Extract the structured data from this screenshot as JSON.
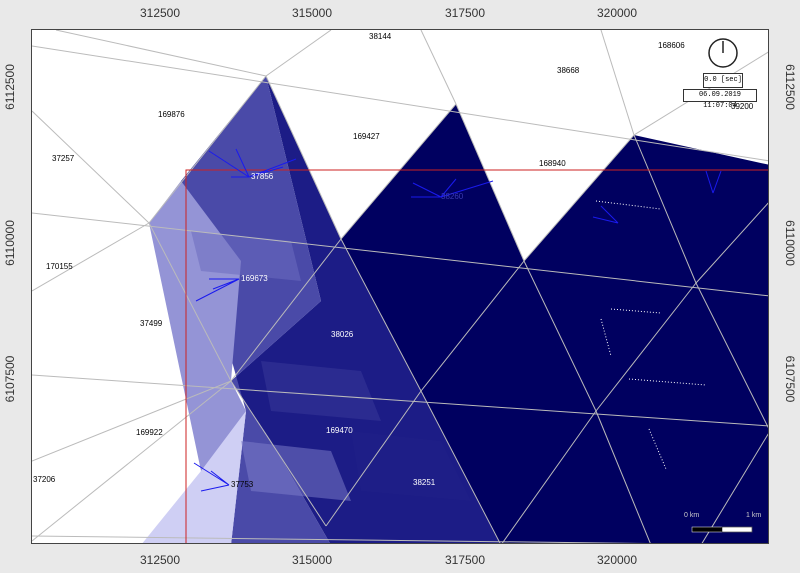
{
  "axes": {
    "x_ticks": [
      "312500",
      "315000",
      "317500",
      "320000"
    ],
    "y_ticks": [
      "6112500",
      "6110000",
      "6107500"
    ]
  },
  "overlay": {
    "time": "0.0 [sec]",
    "datetime": "06.09.2019 11:07:04",
    "scalebar_start": "0 km",
    "scalebar_end": "1 km"
  },
  "colors": {
    "darkest": "#000060",
    "dark": "#1a1a80",
    "mid": "#5050b0",
    "light": "#a0a0dd",
    "lightest": "#cfcff4",
    "mesh_line": "#bbbbbb",
    "boundary": "#cc2222",
    "arrow": "#1a1aee"
  },
  "element_labels": [
    "38144",
    "168606",
    "38668",
    "39200",
    "169876",
    "169427",
    "37257",
    "37856",
    "168940",
    "38260",
    "170155",
    "169673",
    "37499",
    "38026",
    "169922",
    "169470",
    "37206",
    "37753",
    "38251"
  ]
}
